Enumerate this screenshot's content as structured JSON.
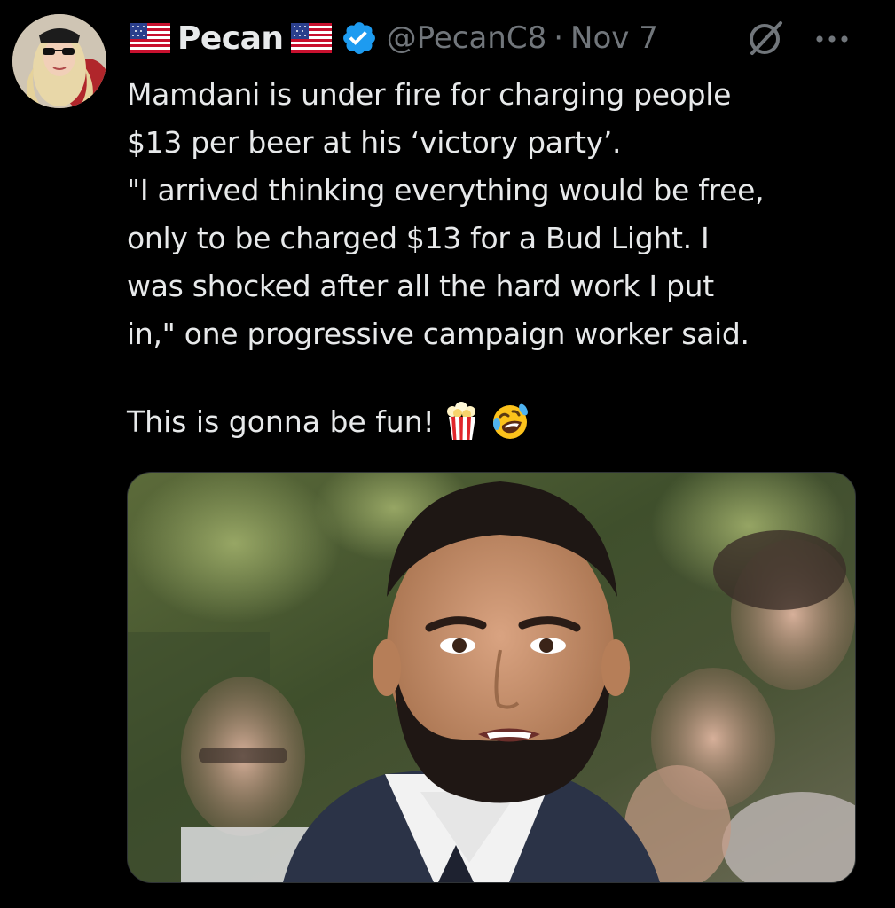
{
  "tweet": {
    "display_name": "Pecan",
    "handle": "@PecanC8",
    "separator": "·",
    "date": "Nov 7",
    "body": "Mamdani is under fire for charging people\n$13 per beer at his ‘victory party’.\n\"I arrived thinking everything would be free,\nonly to be charged $13 for a Bud Light. I\nwas shocked after all the hard work I put\nin,\" one progressive campaign worker said.",
    "closing_line": "This is gonna be fun!",
    "icons": {
      "flag_left": "us-flag-icon",
      "flag_right": "us-flag-icon",
      "verified": "verified-badge-icon",
      "grok": "grok-icon",
      "more": "more-options-icon",
      "emoji_1": "popcorn-emoji",
      "emoji_2": "rolling-on-floor-laughing-emoji"
    }
  },
  "colors": {
    "background": "#000000",
    "primary_text": "#e7e9ea",
    "secondary_text": "#71767b",
    "verified_blue": "#1d9bf0"
  }
}
